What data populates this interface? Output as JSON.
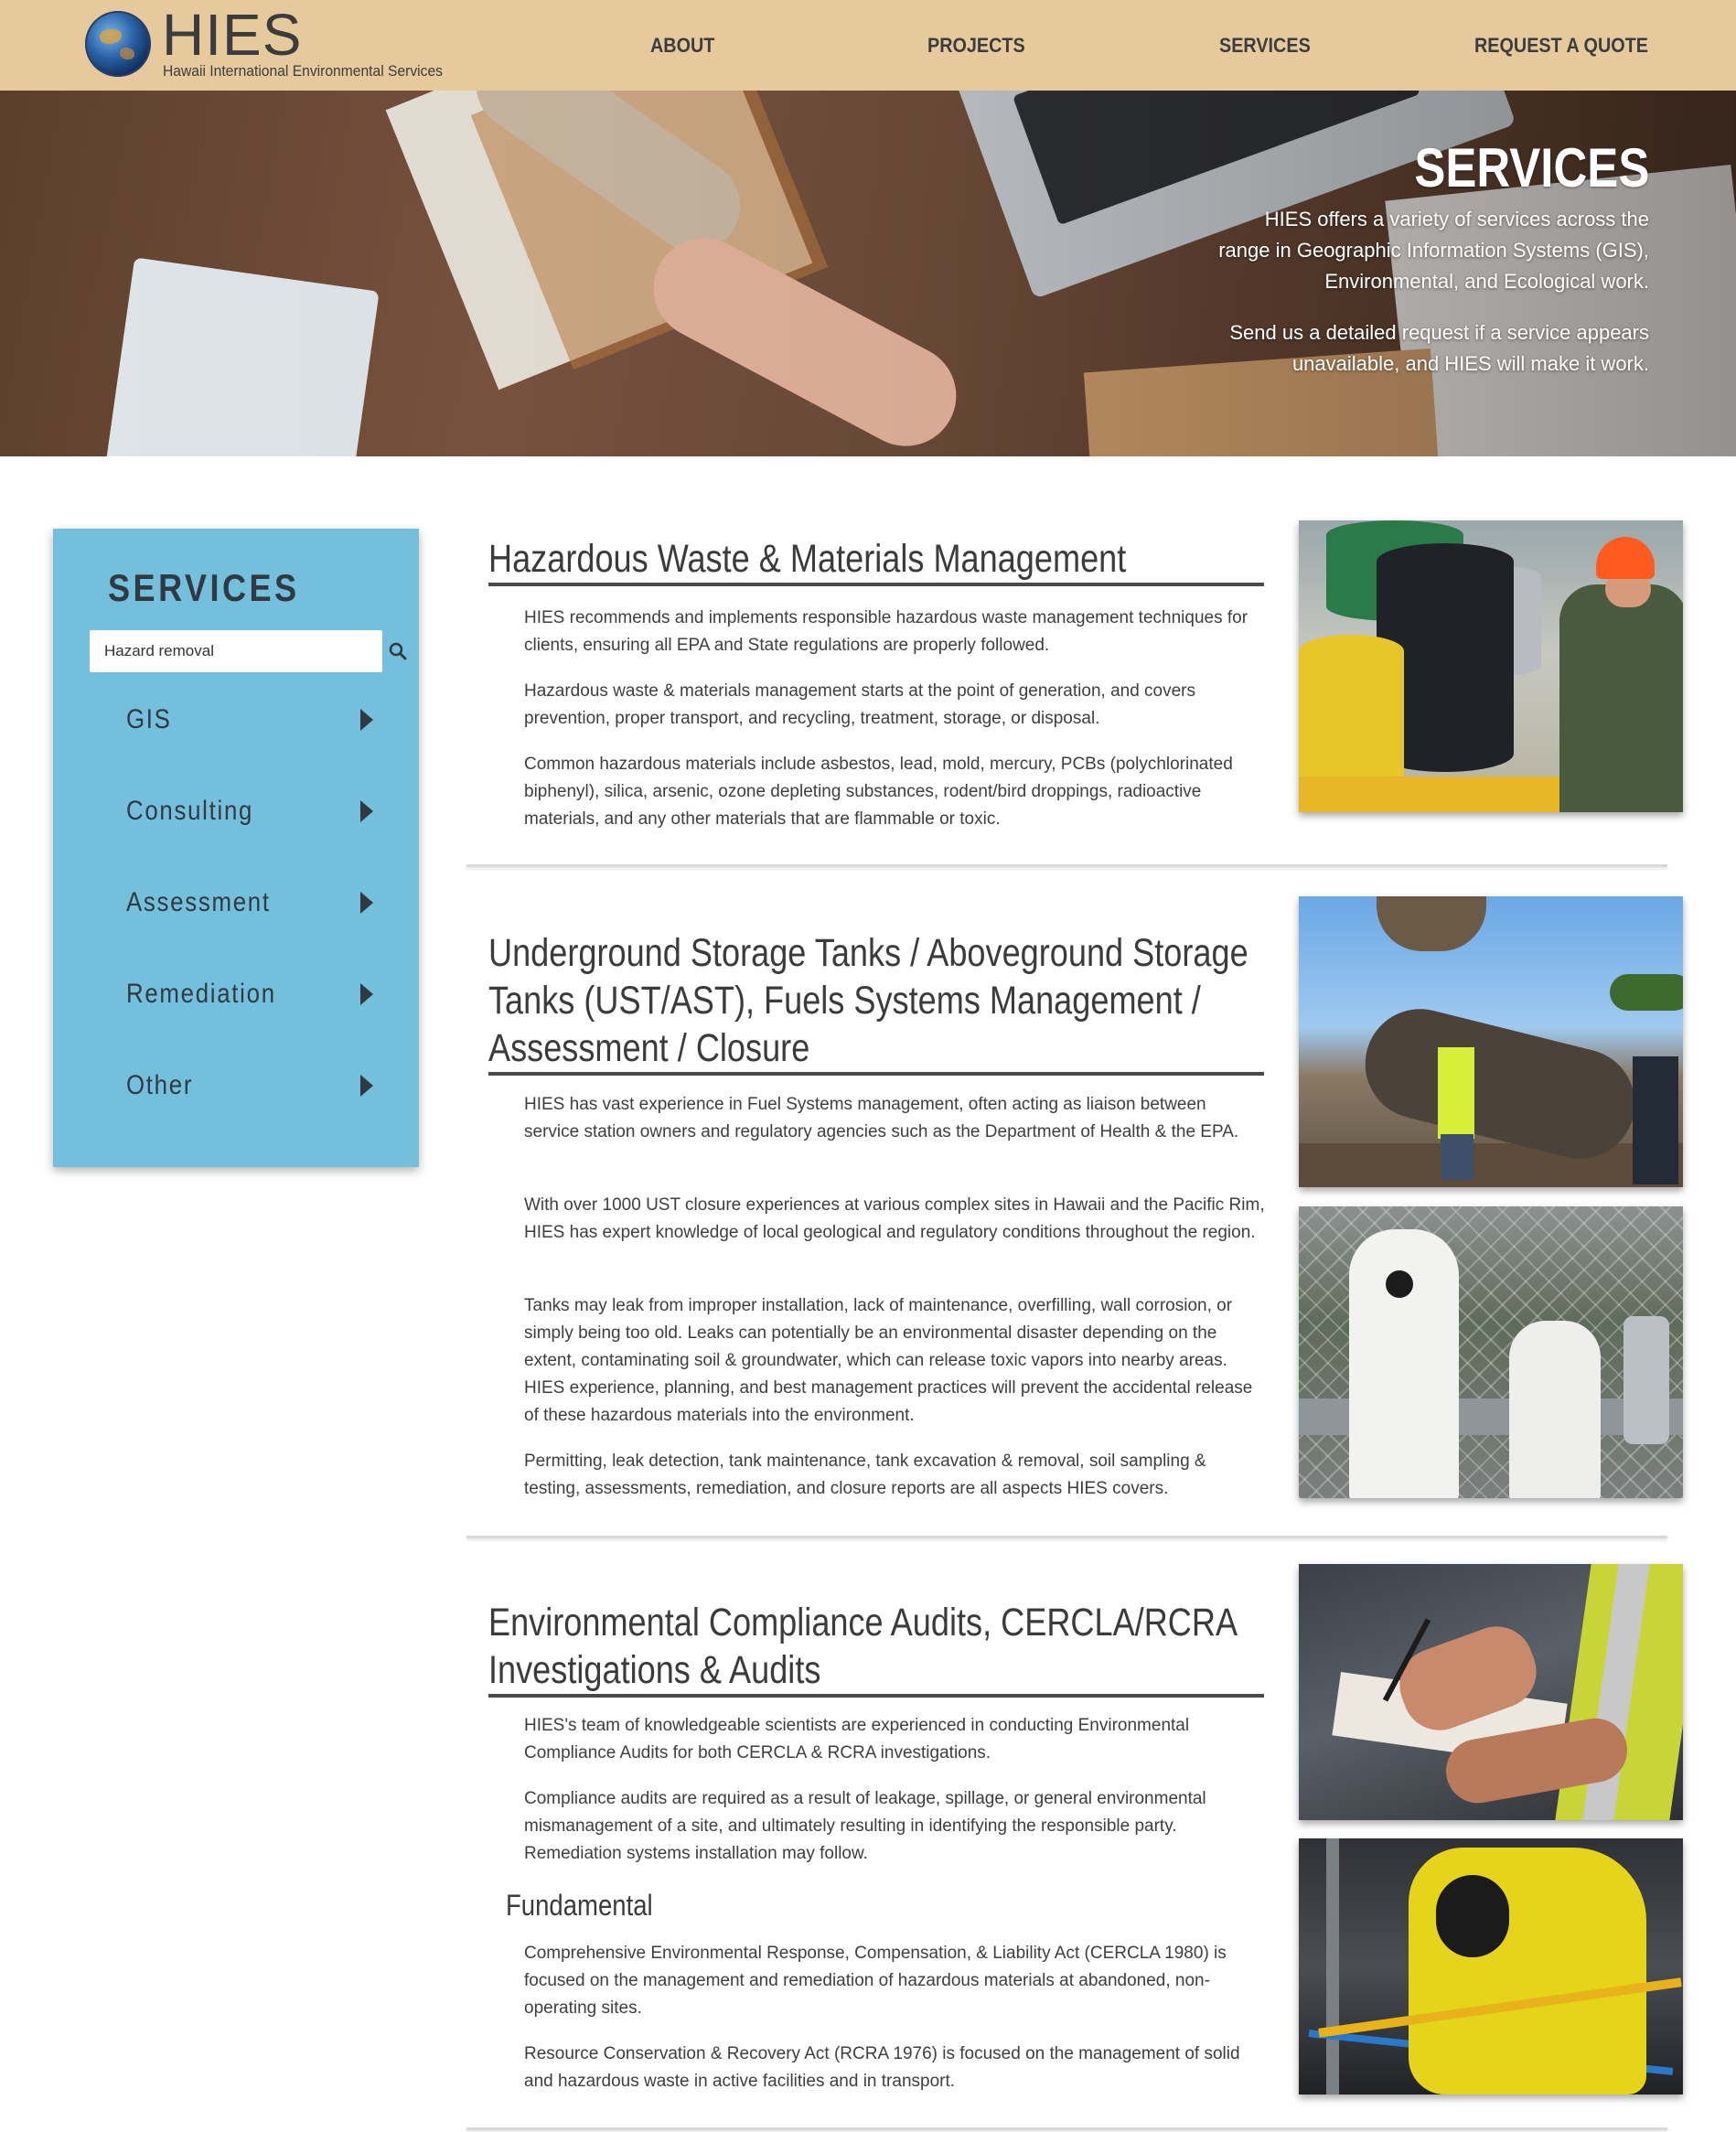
{
  "header": {
    "logo_name": "HIES",
    "logo_sub": "Hawaii International Environmental Services",
    "nav": [
      "ABOUT",
      "PROJECTS",
      "SERVICES",
      "REQUEST A QUOTE"
    ]
  },
  "hero": {
    "title": "SERVICES",
    "text1": "HIES offers a variety of services across the range in Geographic Information Systems (GIS), Environmental, and Ecological work.",
    "text2": "Send us a detailed request if a service appears unavailable, and HIES will make it work."
  },
  "sidebar": {
    "title": "SERVICES",
    "search_value": "Hazard removal",
    "items": [
      "GIS",
      "Consulting",
      "Assessment",
      "Remediation",
      "Other"
    ]
  },
  "sections": [
    {
      "title": "Hazardous Waste & Materials Management",
      "paragraphs": [
        "HIES recommends and implements responsible hazardous waste management techniques for clients, ensuring all EPA and State regulations are properly followed.",
        "Hazardous waste & materials management starts at the point of generation, and covers prevention, proper transport, and recycling, treatment, storage, or disposal.",
        "Common hazardous materials include asbestos, lead, mold, mercury, PCBs (polychlorinated biphenyl), silica, arsenic, ozone depleting substances, rodent/bird droppings, radioactive materials, and any other materials that are flammable or toxic."
      ]
    },
    {
      "title": "Underground Storage Tanks / Aboveground Storage Tanks (UST/AST), Fuels Systems Management / Assessment / Closure",
      "paragraphs": [
        "HIES has vast experience in Fuel Systems management, often acting as liaison between service station owners and regulatory agencies such as the Department of Health & the EPA.",
        "With over 1000 UST closure experiences at various complex sites in Hawaii and the Pacific Rim, HIES has expert knowledge of local geological and regulatory conditions throughout the region.",
        "Tanks may leak from improper installation, lack of maintenance, overfilling, wall corrosion, or simply being too old. Leaks can potentially be an environmental disaster depending on the extent, contaminating soil & groundwater, which can release toxic vapors into nearby areas. HIES experience, planning, and best management practices will prevent the accidental release of these hazardous materials into the environment.",
        "Permitting, leak detection, tank maintenance, tank excavation & removal, soil sampling & testing, assessments, remediation, and closure reports are all aspects HIES covers."
      ]
    },
    {
      "title": "Environmental Compliance Audits, CERCLA/RCRA Investigations & Audits",
      "paragraphs": [
        "HIES's team of knowledgeable scientists are experienced in conducting Environmental Compliance Audits for both CERCLA & RCRA investigations.",
        "Compliance audits are required as a result of leakage, spillage, or general environmental mismanagement of a site, and ultimately resulting in identifying the responsible party. Remediation systems installation may follow."
      ],
      "subheading": "Fundamental",
      "sub_paragraphs": [
        "Comprehensive Environmental Response, Compensation, & Liability Act (CERCLA 1980) is focused on the management and remediation of hazardous materials at abandoned, non-operating sites.",
        "Resource Conservation & Recovery Act (RCRA 1976) is focused on the management of solid and hazardous waste in active facilities and in transport."
      ]
    }
  ],
  "colors": {
    "header_bg": "#e7c99e",
    "sidebar_bg": "#74bfdb",
    "text": "#3b3b3b"
  }
}
